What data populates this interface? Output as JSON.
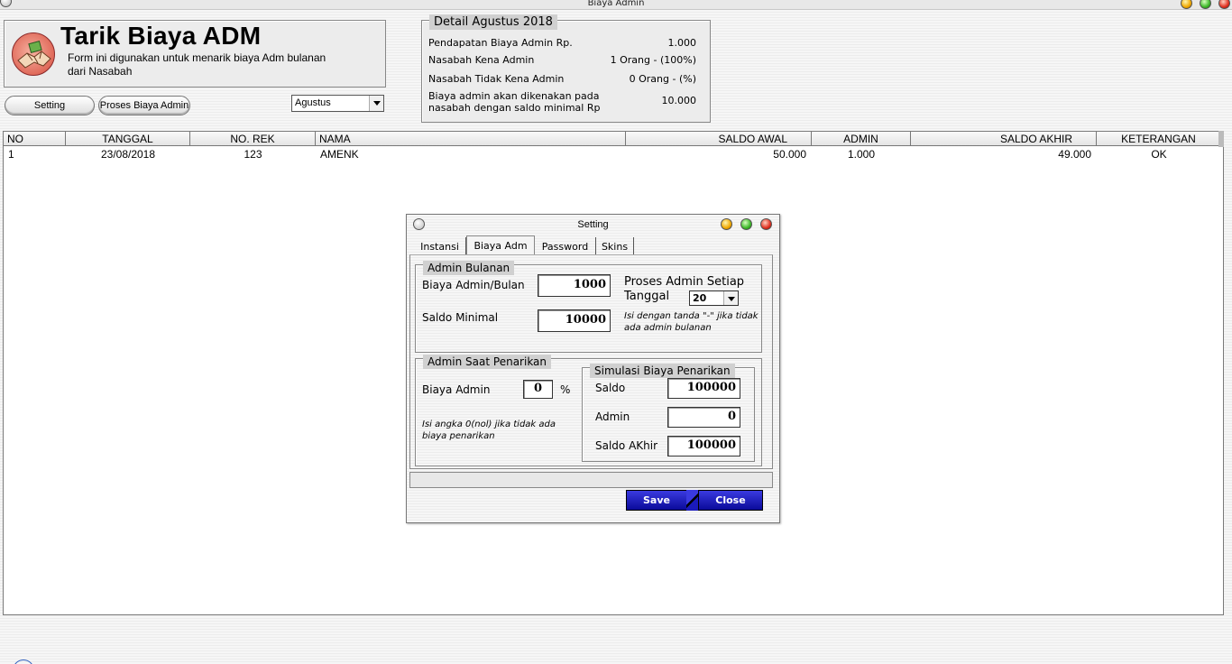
{
  "window": {
    "title": "Biaya Admin"
  },
  "header": {
    "title": "Tarik Biaya ADM",
    "description": "Form ini digunakan untuk menarik biaya Adm bulanan dari Nasabah"
  },
  "toolbar": {
    "setting_label": "Setting",
    "proses_label": "Proses Biaya Admin",
    "month_selected": "Agustus"
  },
  "detail": {
    "title": "Detail Agustus 2018",
    "rows": [
      {
        "label": "Pendapatan Biaya Admin Rp.",
        "value": "1.000"
      },
      {
        "label": "Nasabah Kena Admin",
        "value": "1 Orang - (100%)"
      },
      {
        "label": "Nasabah Tidak Kena Admin",
        "value": "0 Orang - (%)"
      },
      {
        "label": "Biaya admin akan dikenakan pada nasabah dengan saldo minimal Rp",
        "value": "10.000"
      }
    ]
  },
  "table": {
    "headers": [
      "NO",
      "TANGGAL",
      "NO. REK",
      "NAMA",
      "SALDO AWAL",
      "ADMIN",
      "SALDO AKHIR",
      "KETERANGAN"
    ],
    "rows": [
      {
        "no": "1",
        "tanggal": "23/08/2018",
        "norek": "123",
        "nama": "AMENK",
        "saldo_awal": "50.000",
        "admin": "1.000",
        "saldo_akhir": "49.000",
        "keterangan": "OK"
      }
    ]
  },
  "dialog": {
    "title": "Setting",
    "tabs": [
      "Instansi",
      "Biaya Adm",
      "Password",
      "Skins"
    ],
    "active_tab": "Biaya Adm",
    "admin_bulanan": {
      "title": "Admin Bulanan",
      "biaya_label": "Biaya Admin/Bulan",
      "biaya_value": "1000",
      "saldo_label": "Saldo Minimal",
      "saldo_value": "10000",
      "proses_label_1": "Proses Admin Setiap",
      "proses_label_2": "Tanggal",
      "tanggal_value": "20",
      "note": "Isi dengan tanda \"-\" jika tidak ada admin bulanan"
    },
    "admin_penarikan": {
      "title": "Admin Saat Penarikan",
      "biaya_label": "Biaya Admin",
      "biaya_value": "0",
      "percent": "%",
      "note": "Isi angka 0(nol) jika tidak ada biaya penarikan"
    },
    "simulasi": {
      "title": "Simulasi Biaya Penarikan",
      "saldo_label": "Saldo",
      "saldo_value": "100000",
      "admin_label": "Admin",
      "admin_value": "0",
      "saldo_akhir_label": "Saldo AKhir",
      "saldo_akhir_value": "100000"
    },
    "save_label": "Save",
    "close_label": "Close"
  }
}
